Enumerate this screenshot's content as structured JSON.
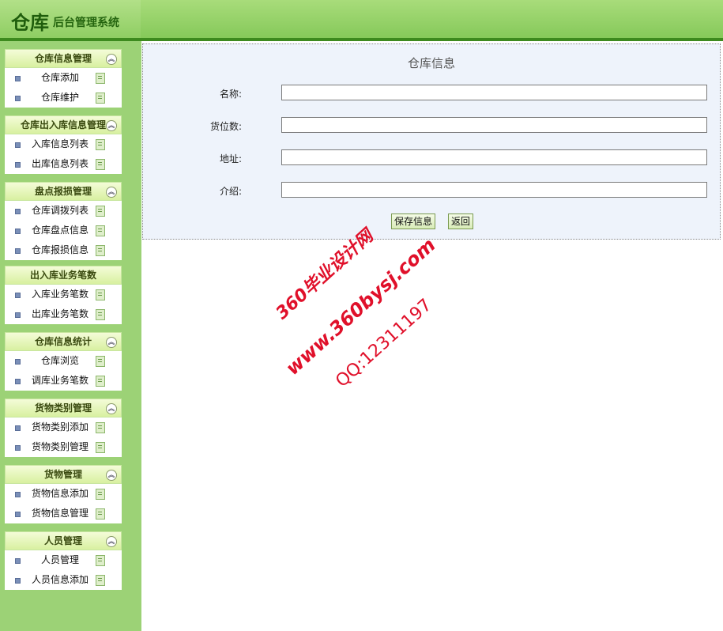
{
  "header": {
    "logo_main": "仓库",
    "logo_sub": "后台管理系统"
  },
  "sidebar": {
    "groups": [
      {
        "title": "仓库信息管理",
        "items": [
          "仓库添加",
          "仓库维护"
        ]
      },
      {
        "title": "仓库出入库信息管理",
        "items": [
          "入库信息列表",
          "出库信息列表"
        ]
      },
      {
        "title": "盘点报损管理",
        "items": [
          "仓库调拨列表",
          "仓库盘点信息",
          "仓库报损信息"
        ]
      },
      {
        "title": "出入库业务笔数",
        "items": [
          "入库业务笔数",
          "出库业务笔数"
        ]
      },
      {
        "title": "仓库信息统计",
        "items": [
          "仓库浏览",
          "调库业务笔数"
        ]
      },
      {
        "title": "货物类别管理",
        "items": [
          "货物类别添加",
          "货物类别管理"
        ]
      },
      {
        "title": "货物管理",
        "items": [
          "货物信息添加",
          "货物信息管理"
        ]
      },
      {
        "title": "人员管理",
        "items": [
          "人员管理",
          "人员信息添加"
        ]
      }
    ]
  },
  "form": {
    "title": "仓库信息",
    "fields": [
      {
        "label": "名称:",
        "value": ""
      },
      {
        "label": "货位数:",
        "value": ""
      },
      {
        "label": "地址:",
        "value": ""
      },
      {
        "label": "介绍:",
        "value": ""
      }
    ],
    "save_label": "保存信息",
    "back_label": "返回"
  },
  "watermark": {
    "line1": "360毕业设计网",
    "line2": "www.360bysj.com",
    "line3": "QQ:12311197",
    "color": "#e0102a"
  },
  "colors": {
    "header_green": "#86c95a",
    "header_border": "#3d8a1e",
    "sidebar_green": "#9cd276",
    "panel_bg": "#eef3fb"
  }
}
